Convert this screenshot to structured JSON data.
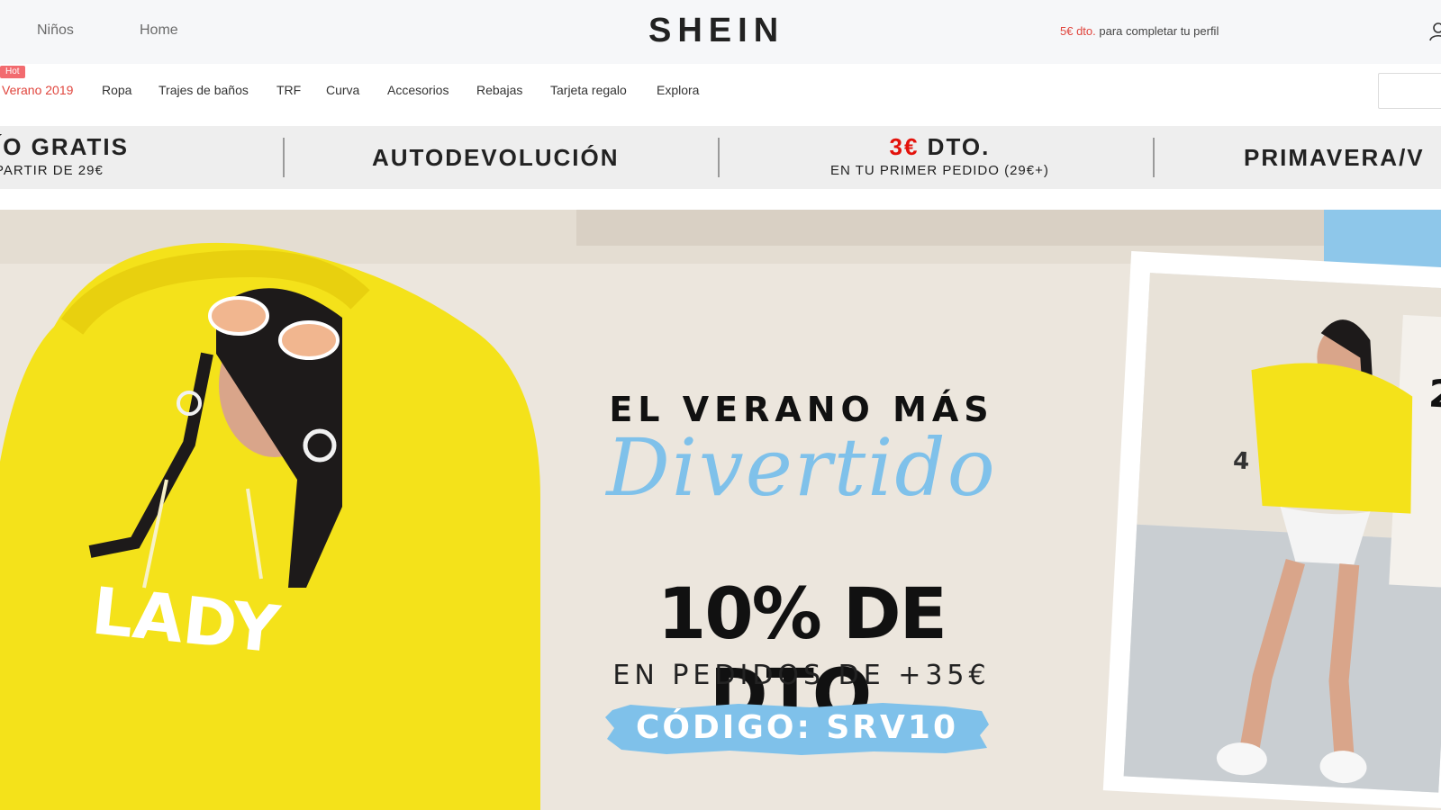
{
  "header": {
    "nav_left": [
      "Niños",
      "Home"
    ],
    "logo": "SHEIN",
    "promo_red": "5€ dto.",
    "promo_rest": " para completar tu perfil"
  },
  "categories": {
    "hot_badge": "Hot",
    "items": [
      "Verano 2019",
      "Ropa",
      "Trajes de baños",
      "TRF",
      "Curva",
      "Accesorios",
      "Rebajas",
      "Tarjeta regalo",
      "Explora"
    ]
  },
  "benefits": {
    "shipping_title": "ÍO GRATIS",
    "shipping_sub": "PARTIR DE 29€",
    "return_title": "AUTODEVOLUCIÓN",
    "discount_red": "3€",
    "discount_title": " DTO.",
    "discount_sub": "EN TU PRIMER PEDIDO (29€+)",
    "season_title": "PRIMAVERA/V"
  },
  "hero": {
    "line1": "EL VERANO MÁS",
    "line2": "Divertido",
    "line3": "10% DE DTO.",
    "line4": "EN PEDIDOS DE +35€",
    "code": "CÓDIGO: SRV10",
    "sweater_text": "LADY",
    "number_a": "4",
    "number_b": "2"
  },
  "colors": {
    "accent_red": "#e0453d",
    "hero_blue": "#7fc1ea",
    "sweater_yellow": "#f4e21a"
  }
}
